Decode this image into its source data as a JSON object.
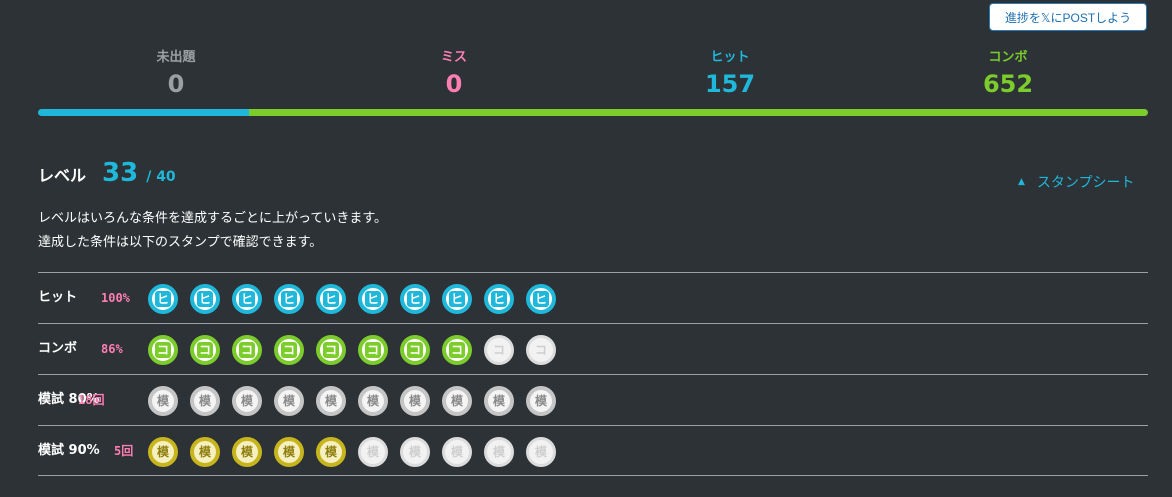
{
  "post_button": {
    "label": "進捗を𝕏にPOSTしよう"
  },
  "stats": [
    {
      "label": "未出題",
      "value": "0",
      "color": "#9aa0a3"
    },
    {
      "label": "ミス",
      "value": "0",
      "color": "#ff7fb2"
    },
    {
      "label": "ヒット",
      "value": "157",
      "color": "#1fb8db"
    },
    {
      "label": "コンボ",
      "value": "652",
      "color": "#7ccc2c"
    }
  ],
  "progress": {
    "segments": [
      {
        "name": "hit",
        "fraction": 0.19,
        "color": "#1fb8db"
      },
      {
        "name": "combo",
        "fraction": 0.81,
        "color": "#7ccc2c"
      }
    ]
  },
  "level": {
    "label": "レベル",
    "current": "33",
    "max": "/ 40"
  },
  "stamp_sheet_link": {
    "label": "スタンプシート"
  },
  "description": [
    "レベルはいろんな条件を達成するごとに上がっていきます。",
    "達成した条件は以下のスタンプで確認できます。"
  ],
  "rows": [
    {
      "name": "ヒット",
      "rate": "100%",
      "rate_color": "#ff7fb2",
      "glyph": "ヒ",
      "on_style": "on-blue",
      "earned": 10,
      "total": 10
    },
    {
      "name": "コンボ",
      "rate": "86%",
      "rate_color": "#ff7fb2",
      "glyph": "コ",
      "on_style": "on-green",
      "earned": 8,
      "total": 10
    },
    {
      "name": "模試 80%",
      "rate": "18回",
      "rate_color": "#ff7fb2",
      "glyph": "模",
      "on_style": "on-gray",
      "earned": 10,
      "total": 10
    },
    {
      "name": "模試 90%",
      "rate": "5回",
      "rate_color": "#ff7fb2",
      "glyph": "模",
      "on_style": "on-gold",
      "earned": 5,
      "total": 10
    }
  ]
}
